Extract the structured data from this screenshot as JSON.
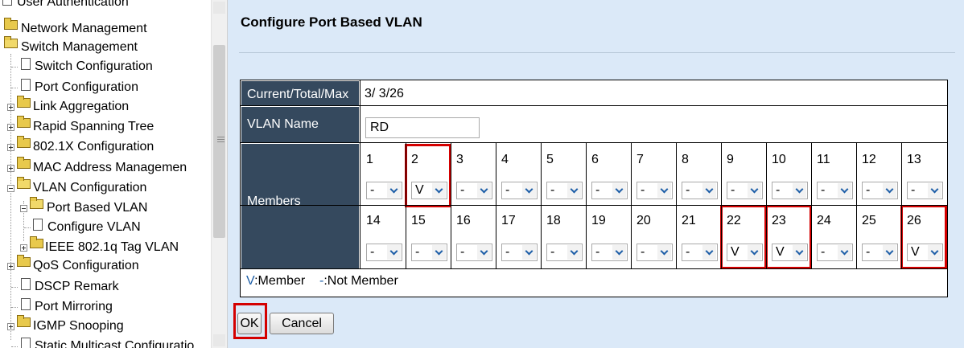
{
  "sidebar": {
    "items": [
      {
        "label": "User Authentication"
      },
      {
        "label": "Network Management"
      },
      {
        "label": "Switch Management"
      },
      {
        "label": "Switch Configuration"
      },
      {
        "label": "Port Configuration"
      },
      {
        "label": "Link Aggregation"
      },
      {
        "label": "Rapid Spanning Tree"
      },
      {
        "label": "802.1X Configuration"
      },
      {
        "label": "MAC Address Managemen"
      },
      {
        "label": "VLAN Configuration"
      },
      {
        "label": "Port Based VLAN"
      },
      {
        "label": "Configure VLAN"
      },
      {
        "label": "IEEE 802.1q Tag VLAN"
      },
      {
        "label": "QoS Configuration"
      },
      {
        "label": "DSCP Remark"
      },
      {
        "label": "Port Mirroring"
      },
      {
        "label": "IGMP Snooping"
      },
      {
        "label": "Static Multicast Configuratio"
      }
    ]
  },
  "main": {
    "title": "Configure Port Based VLAN",
    "current_total_max": {
      "label": "Current/Total/Max",
      "value": "3/ 3/26"
    },
    "vlan_name": {
      "label": "VLAN Name",
      "value": "RD"
    },
    "members": {
      "label": "Members",
      "ports": [
        {
          "num": "1",
          "value": "-"
        },
        {
          "num": "2",
          "value": "V"
        },
        {
          "num": "3",
          "value": "-"
        },
        {
          "num": "4",
          "value": "-"
        },
        {
          "num": "5",
          "value": "-"
        },
        {
          "num": "6",
          "value": "-"
        },
        {
          "num": "7",
          "value": "-"
        },
        {
          "num": "8",
          "value": "-"
        },
        {
          "num": "9",
          "value": "-"
        },
        {
          "num": "10",
          "value": "-"
        },
        {
          "num": "11",
          "value": "-"
        },
        {
          "num": "12",
          "value": "-"
        },
        {
          "num": "13",
          "value": "-"
        },
        {
          "num": "14",
          "value": "-"
        },
        {
          "num": "15",
          "value": "-"
        },
        {
          "num": "16",
          "value": "-"
        },
        {
          "num": "17",
          "value": "-"
        },
        {
          "num": "18",
          "value": "-"
        },
        {
          "num": "19",
          "value": "-"
        },
        {
          "num": "20",
          "value": "-"
        },
        {
          "num": "21",
          "value": "-"
        },
        {
          "num": "22",
          "value": "V"
        },
        {
          "num": "23",
          "value": "V"
        },
        {
          "num": "24",
          "value": "-"
        },
        {
          "num": "25",
          "value": "-"
        },
        {
          "num": "26",
          "value": "V"
        }
      ]
    },
    "legend": {
      "member_symbol": "V",
      "member_text": ":Member",
      "not_member_symbol": "-",
      "not_member_text": ":Not Member"
    },
    "buttons": {
      "ok": "OK",
      "cancel": "Cancel"
    }
  },
  "colors": {
    "header_bg": "#35495e",
    "page_bg": "#dbe9f8",
    "highlight": "#d40000",
    "legend_symbol": "#1e5fa8"
  }
}
